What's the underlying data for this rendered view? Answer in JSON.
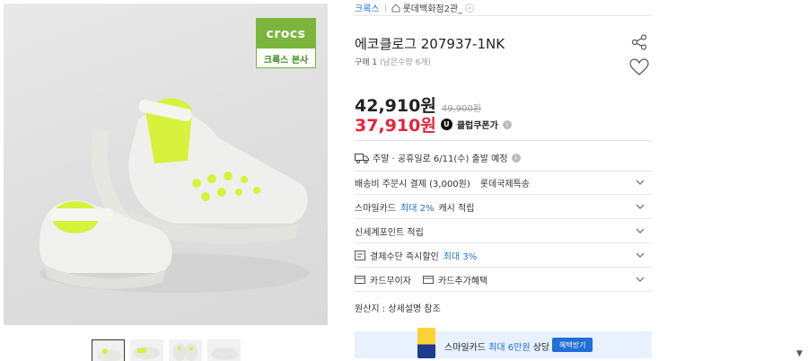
{
  "gallery": {
    "brand_logo_text": "crocs",
    "brand_badge_text": "크록스 본사",
    "thumbnail_count": 4
  },
  "breadcrumb": {
    "brand": "크록스",
    "store": "롯데백화점2관_"
  },
  "product": {
    "title": "에코클로그 207937-1NK",
    "purchase_label": "구매 1",
    "remaining": "(남은수량 6개)"
  },
  "pricing": {
    "price": "42,910원",
    "original_price": "49,900원",
    "coupon_price": "37,910원",
    "coupon_badge": "U",
    "coupon_label": "클럽쿠폰가",
    "info_glyph": "i"
  },
  "delivery": {
    "text": "주말 · 공휴일로 6/11(수) 출발 예정",
    "info_glyph": "i"
  },
  "options": [
    {
      "label": "배송비 주문시 결제 (3,000원)",
      "extra": "롯데국제특송"
    },
    {
      "label": "스마일카드",
      "highlight": "최대 2%",
      "suffix": "캐시 적립"
    },
    {
      "label": "신세계포인트 적립"
    },
    {
      "label": "결제수단 즉시할인",
      "highlight": "최대 3%"
    },
    {
      "label": "카드무이자",
      "extra": "카드추가혜택"
    }
  ],
  "origin": "원산지 : 상세설명 참조",
  "banner": {
    "text_prefix": "스마일카드",
    "text_highlight": "최대 6만원",
    "text_suffix": "상당 혜택",
    "button_label": "혜택받기"
  },
  "icons": {
    "share": "share-icon",
    "wishlist": "heart-icon",
    "delivery": "truck-icon",
    "discount": "receipt-icon",
    "card": "card-icon",
    "expand": "chevron-down-icon"
  },
  "colors": {
    "accent_blue": "#1f6fd6",
    "price_red": "#e4243b",
    "brand_green": "#7bb53c",
    "product_lime": "#d7f23a"
  }
}
